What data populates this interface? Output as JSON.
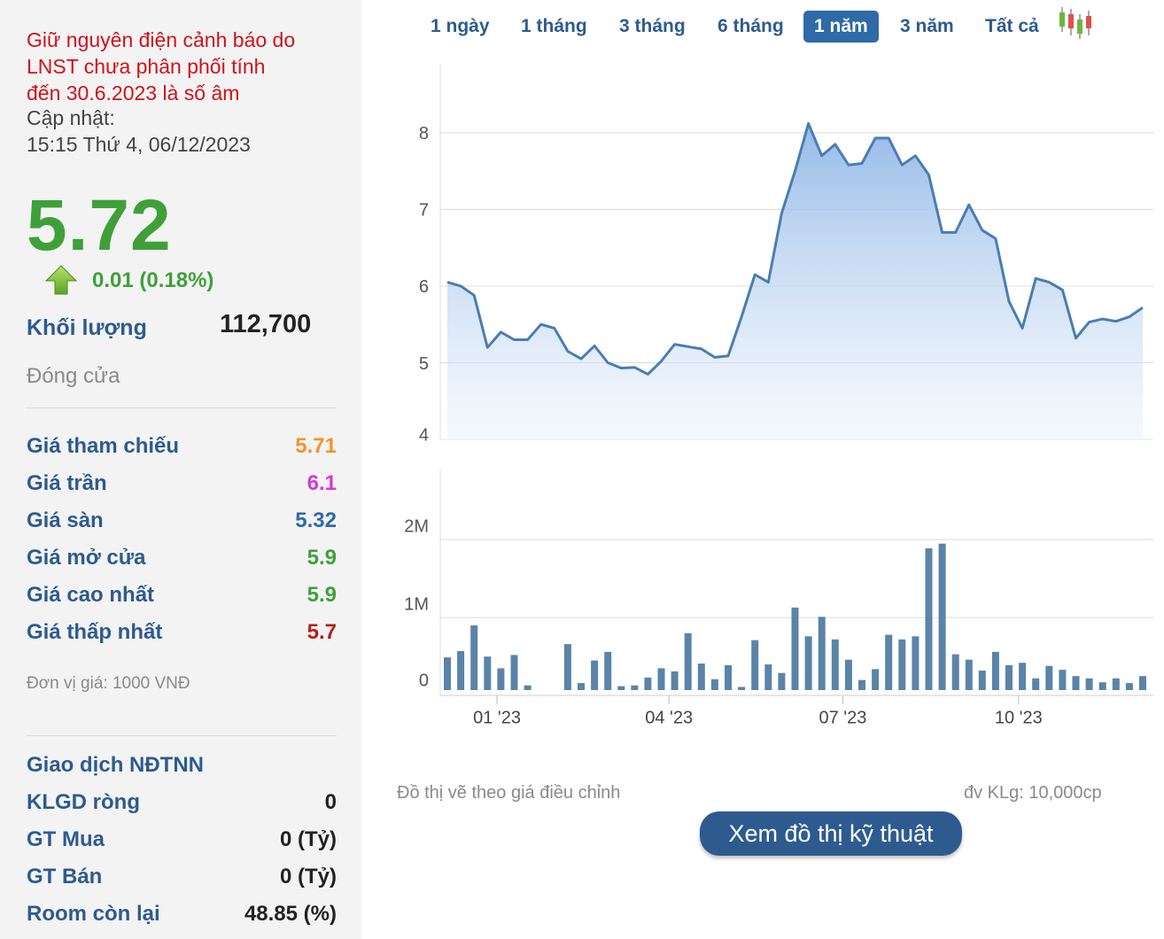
{
  "summary": {
    "warning_lines": [
      "Giữ nguyên điện cảnh báo do",
      "LNST chưa phân phối tính",
      "đến 30.6.2023 là số âm"
    ],
    "updated_label": "Cập nhật:",
    "updated_time": "15:15 Thứ 4, 06/12/2023",
    "price": "5.72",
    "change": "0.01 (0.18%)",
    "volume_label": "Khối lượng",
    "volume_value": "112,700",
    "status": "Đóng cửa",
    "colors": {
      "up": "#3fa03a",
      "reference": "#f0962a",
      "ceiling": "#d63ad1",
      "floor": "#2e6aa8",
      "down": "#b0221c"
    }
  },
  "prices": [
    {
      "label": "Giá tham chiếu",
      "value": "5.71",
      "color": "#f0962a"
    },
    {
      "label": "Giá trần",
      "value": "6.1",
      "color": "#d63ad1"
    },
    {
      "label": "Giá sàn",
      "value": "5.32",
      "color": "#2e6aa8"
    },
    {
      "label": "Giá mở cửa",
      "value": "5.9",
      "color": "#3fa03a"
    },
    {
      "label": "Giá cao nhất",
      "value": "5.9",
      "color": "#3fa03a"
    },
    {
      "label": "Giá thấp nhất",
      "value": "5.7",
      "color": "#b0221c"
    }
  ],
  "unit_note": "Đơn vị giá: 1000 VNĐ",
  "foreign": {
    "title": "Giao dịch NĐTNN",
    "rows": [
      {
        "label": "KLGD ròng",
        "value": "0"
      },
      {
        "label": "GT Mua",
        "value": "0 (Tỷ)"
      },
      {
        "label": "GT Bán",
        "value": "0 (Tỷ)"
      },
      {
        "label": "Room còn lại",
        "value": "48.85 (%)"
      }
    ]
  },
  "periods": [
    {
      "label": "1 ngày",
      "active": false
    },
    {
      "label": "1 tháng",
      "active": false
    },
    {
      "label": "3 tháng",
      "active": false
    },
    {
      "label": "6 tháng",
      "active": false
    },
    {
      "label": "1 năm",
      "active": true
    },
    {
      "label": "3 năm",
      "active": false
    },
    {
      "label": "Tất cả",
      "active": false
    }
  ],
  "footer": {
    "note_left": "Đồ thị vẽ theo giá điều chỉnh",
    "note_right": "đv KLg: 10,000cp",
    "technical_button": "Xem đồ thị kỹ thuật"
  },
  "chart_data": [
    {
      "type": "area",
      "yticks": [
        "4",
        "5",
        "6",
        "7",
        "8"
      ],
      "ylim": [
        4,
        8.9
      ],
      "grid": true,
      "line_color": "#4a7db3",
      "fill_color": "#8fb6e6",
      "x": [
        "2022-12-06",
        "2022-12-13",
        "2022-12-20",
        "2022-12-27",
        "2023-01-03",
        "2023-01-10",
        "2023-01-17",
        "2023-01-24",
        "2023-01-31",
        "2023-02-07",
        "2023-02-14",
        "2023-02-21",
        "2023-02-28",
        "2023-03-07",
        "2023-03-14",
        "2023-03-21",
        "2023-03-28",
        "2023-04-04",
        "2023-04-11",
        "2023-04-18",
        "2023-04-25",
        "2023-05-02",
        "2023-05-09",
        "2023-05-16",
        "2023-05-23",
        "2023-05-30",
        "2023-06-06",
        "2023-06-13",
        "2023-06-20",
        "2023-06-27",
        "2023-07-04",
        "2023-07-11",
        "2023-07-18",
        "2023-07-25",
        "2023-08-01",
        "2023-08-08",
        "2023-08-15",
        "2023-08-22",
        "2023-08-29",
        "2023-09-05",
        "2023-09-12",
        "2023-09-19",
        "2023-09-26",
        "2023-10-03",
        "2023-10-10",
        "2023-10-17",
        "2023-10-24",
        "2023-10-31",
        "2023-11-07",
        "2023-11-14",
        "2023-11-21",
        "2023-11-28",
        "2023-12-05"
      ],
      "values": [
        6.05,
        6.0,
        5.88,
        5.2,
        5.4,
        5.3,
        5.3,
        5.5,
        5.45,
        5.15,
        5.05,
        5.22,
        5.0,
        4.93,
        4.94,
        4.85,
        5.02,
        5.24,
        5.21,
        5.18,
        5.07,
        5.09,
        5.6,
        6.15,
        6.05,
        6.95,
        7.5,
        8.12,
        7.7,
        7.85,
        7.58,
        7.6,
        7.93,
        7.93,
        7.58,
        7.7,
        7.45,
        6.7,
        6.7,
        7.06,
        6.73,
        6.62,
        5.8,
        5.45,
        6.1,
        6.05,
        5.95,
        5.32,
        5.53,
        5.57,
        5.54,
        5.6,
        5.72
      ]
    },
    {
      "type": "bar",
      "yticks": [
        "0",
        "1M",
        "2M"
      ],
      "ylim": [
        0,
        2.9
      ],
      "xticks": [
        "01 '23",
        "04 '23",
        "07 '23",
        "10 '23"
      ],
      "grid": true,
      "bar_color": "#5a84a8",
      "x": [
        "2022-12-06",
        "2022-12-13",
        "2022-12-20",
        "2022-12-27",
        "2023-01-03",
        "2023-01-10",
        "2023-01-17",
        "2023-01-24",
        "2023-01-31",
        "2023-02-07",
        "2023-02-14",
        "2023-02-21",
        "2023-02-28",
        "2023-03-07",
        "2023-03-14",
        "2023-03-21",
        "2023-03-28",
        "2023-04-04",
        "2023-04-11",
        "2023-04-18",
        "2023-04-25",
        "2023-05-02",
        "2023-05-09",
        "2023-05-16",
        "2023-05-23",
        "2023-05-30",
        "2023-06-06",
        "2023-06-13",
        "2023-06-20",
        "2023-06-27",
        "2023-07-04",
        "2023-07-11",
        "2023-07-18",
        "2023-07-25",
        "2023-08-01",
        "2023-08-08",
        "2023-08-15",
        "2023-08-22",
        "2023-08-29",
        "2023-09-05",
        "2023-09-12",
        "2023-09-19",
        "2023-09-26",
        "2023-10-03",
        "2023-10-10",
        "2023-10-17",
        "2023-10-24",
        "2023-10-31",
        "2023-11-07",
        "2023-11-14",
        "2023-11-21",
        "2023-11-28",
        "2023-12-05"
      ],
      "values": [
        0.42,
        0.5,
        0.83,
        0.43,
        0.28,
        0.45,
        0.06,
        0.0,
        0.0,
        0.59,
        0.09,
        0.38,
        0.49,
        0.05,
        0.06,
        0.16,
        0.28,
        0.24,
        0.73,
        0.34,
        0.14,
        0.32,
        0.04,
        0.64,
        0.33,
        0.22,
        1.06,
        0.69,
        0.94,
        0.65,
        0.39,
        0.13,
        0.27,
        0.71,
        0.65,
        0.69,
        1.82,
        1.88,
        0.46,
        0.39,
        0.25,
        0.49,
        0.32,
        0.35,
        0.15,
        0.31,
        0.26,
        0.18,
        0.15,
        0.1,
        0.15,
        0.09,
        0.18
      ]
    }
  ]
}
